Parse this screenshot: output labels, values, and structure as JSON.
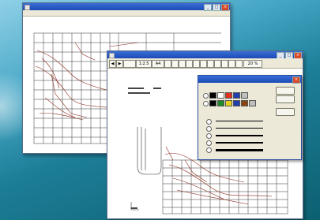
{
  "window_back": {
    "title": "",
    "menu": []
  },
  "window_front": {
    "title": "",
    "menu": [],
    "toolbar": {
      "field1": "1:2.5",
      "field2": "A4",
      "zoom": "20 %"
    }
  },
  "dialog": {
    "title": "",
    "color_label": "",
    "line_label": "",
    "buttons": [
      "",
      "",
      ""
    ],
    "colors": [
      "#000000",
      "#ffffff",
      "#e03020",
      "#1f3fae",
      "#bfbfbf",
      "#000000",
      "#1e8a2a",
      "#e6d021",
      "#1f3fae",
      "#8b4513",
      "#bfbfbf"
    ]
  }
}
